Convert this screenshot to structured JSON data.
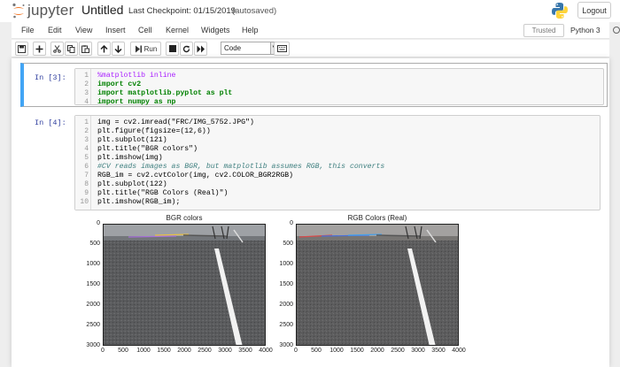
{
  "header": {
    "logo_text": "jupyter",
    "notebook_name": "Untitled",
    "checkpoint": "Last Checkpoint: 01/15/2019",
    "autosave": "(autosaved)",
    "logout_label": "Logout"
  },
  "menu": {
    "items": [
      "File",
      "Edit",
      "View",
      "Insert",
      "Cell",
      "Kernel",
      "Widgets",
      "Help"
    ],
    "trusted_label": "Trusted",
    "kernel_label": "Python 3"
  },
  "toolbar": {
    "run_label": "Run",
    "cell_type": "Code"
  },
  "cells": [
    {
      "prompt": "In [3]:",
      "line_numbers": [
        "1",
        "2",
        "3",
        "4"
      ],
      "lines": [
        "%matplotlib inline",
        "import cv2",
        "import matplotlib.pyplot as plt",
        "import numpy as np"
      ]
    },
    {
      "prompt": "In [4]:",
      "line_numbers": [
        "1",
        "2",
        "3",
        "4",
        "5",
        "6",
        "7",
        "8",
        "9",
        "10"
      ],
      "lines": [
        "img = cv2.imread(\"FRC/IMG_5752.JPG\")",
        "plt.figure(figsize=(12,6))",
        "plt.subplot(121)",
        "plt.title(\"BGR colors\")",
        "plt.imshow(img)",
        "#CV reads images as BGR, but matplotlib assumes RGB, this converts",
        "RGB_im = cv2.cvtColor(img, cv2.COLOR_BGR2RGB)",
        "plt.subplot(122)",
        "plt.title(\"RGB Colors (Real)\")",
        "plt.imshow(RGB_im);"
      ]
    }
  ],
  "output": {
    "plot1_title": "BGR colors",
    "plot2_title": "RGB Colors (Real)",
    "y_ticks": [
      "0",
      "500",
      "1000",
      "1500",
      "2000",
      "2500",
      "3000"
    ],
    "x_ticks": [
      "0",
      "500",
      "1000",
      "1500",
      "2000",
      "2500",
      "3000",
      "3500",
      "4000"
    ]
  }
}
